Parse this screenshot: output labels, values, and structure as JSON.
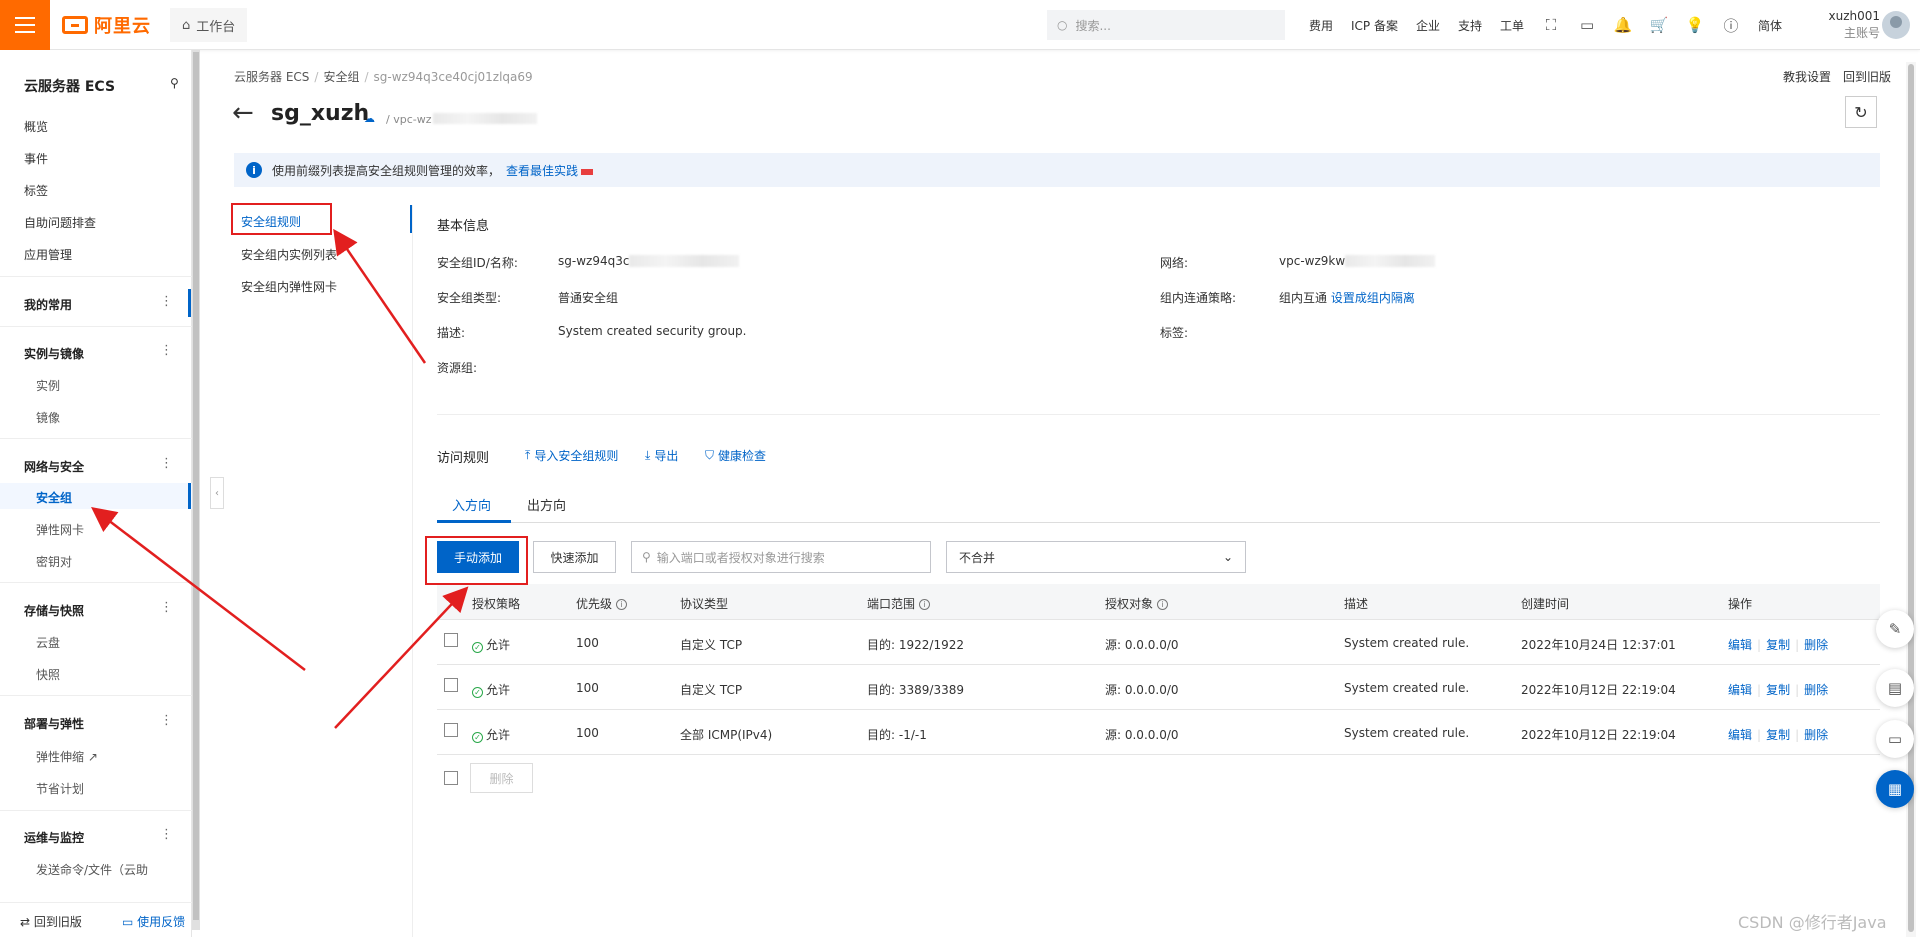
{
  "topbar": {
    "logo_text": "阿里云",
    "workbench": "工作台",
    "search_placeholder": "搜索...",
    "nav": [
      "费用",
      "ICP 备案",
      "企业",
      "支持",
      "工单"
    ],
    "lang": "简体",
    "user_name": "xuzh001",
    "user_role": "主账号"
  },
  "sidebar": {
    "title": "云服务器 ECS",
    "items": [
      "概览",
      "事件",
      "标签",
      "自助问题排查",
      "应用管理"
    ],
    "my_common": "我的常用",
    "groups": [
      {
        "label": "实例与镜像",
        "items": [
          "实例",
          "镜像"
        ]
      },
      {
        "label": "网络与安全",
        "items": [
          "安全组",
          "弹性网卡",
          "密钥对"
        ]
      },
      {
        "label": "存储与快照",
        "items": [
          "云盘",
          "快照"
        ]
      },
      {
        "label": "部署与弹性",
        "items": [
          "弹性伸缩",
          "节省计划"
        ]
      },
      {
        "label": "运维与监控",
        "items": [
          "发送命令/文件（云助"
        ]
      }
    ],
    "footer_back": "回到旧版",
    "footer_feedback": "使用反馈"
  },
  "breadcrumb": [
    "云服务器 ECS",
    "安全组",
    "sg-wz94q3ce40cj01zlqa69"
  ],
  "top_links": [
    "教我设置",
    "回到旧版"
  ],
  "page": {
    "title": "sg_xuzh",
    "vpc": "/ vpc-wz"
  },
  "notice": {
    "text": "使用前缀列表提高安全组规则管理的效率，",
    "link": "查看最佳实践"
  },
  "subnav": [
    "安全组规则",
    "安全组内实例列表",
    "安全组内弹性网卡"
  ],
  "basic_info": {
    "title": "基本信息",
    "id_label": "安全组ID/名称:",
    "id_value": "sg-wz94q3c",
    "type_label": "安全组类型:",
    "type_value": "普通安全组",
    "desc_label": "描述:",
    "desc_value": "System created security group.",
    "rg_label": "资源组:",
    "net_label": "网络:",
    "net_value": "vpc-wz9kw",
    "policy_label": "组内连通策略:",
    "policy_value": "组内互通",
    "policy_link": "设置成组内隔离",
    "tag_label": "标签:"
  },
  "rules": {
    "title": "访问规则",
    "import": "导入安全组规则",
    "export": "导出",
    "health": "健康检查",
    "tab_in": "入方向",
    "tab_out": "出方向",
    "manual_add": "手动添加",
    "quick_add": "快速添加",
    "search_placeholder": "输入端口或者授权对象进行搜索",
    "merge_select": "不合并",
    "delete": "删除",
    "columns": [
      "授权策略",
      "优先级",
      "协议类型",
      "端口范围",
      "授权对象",
      "描述",
      "创建时间",
      "操作"
    ],
    "rows": [
      {
        "policy": "允许",
        "priority": "100",
        "protocol": "自定义 TCP",
        "port": "目的: 1922/1922",
        "object": "源: 0.0.0.0/0",
        "desc": "System created rule.",
        "time": "2022年10月24日 12:37:01"
      },
      {
        "policy": "允许",
        "priority": "100",
        "protocol": "自定义 TCP",
        "port": "目的: 3389/3389",
        "object": "源: 0.0.0.0/0",
        "desc": "System created rule.",
        "time": "2022年10月12日 22:19:04"
      },
      {
        "policy": "允许",
        "priority": "100",
        "protocol": "全部 ICMP(IPv4)",
        "port": "目的: -1/-1",
        "object": "源: 0.0.0.0/0",
        "desc": "System created rule.",
        "time": "2022年10月12日 22:19:04"
      }
    ],
    "ops": [
      "编辑",
      "复制",
      "删除"
    ]
  },
  "watermark": "CSDN @修行者Java",
  "colors": {
    "brand": "#ff6a00",
    "accent": "#0064c8",
    "annotation": "#e21f1f"
  }
}
